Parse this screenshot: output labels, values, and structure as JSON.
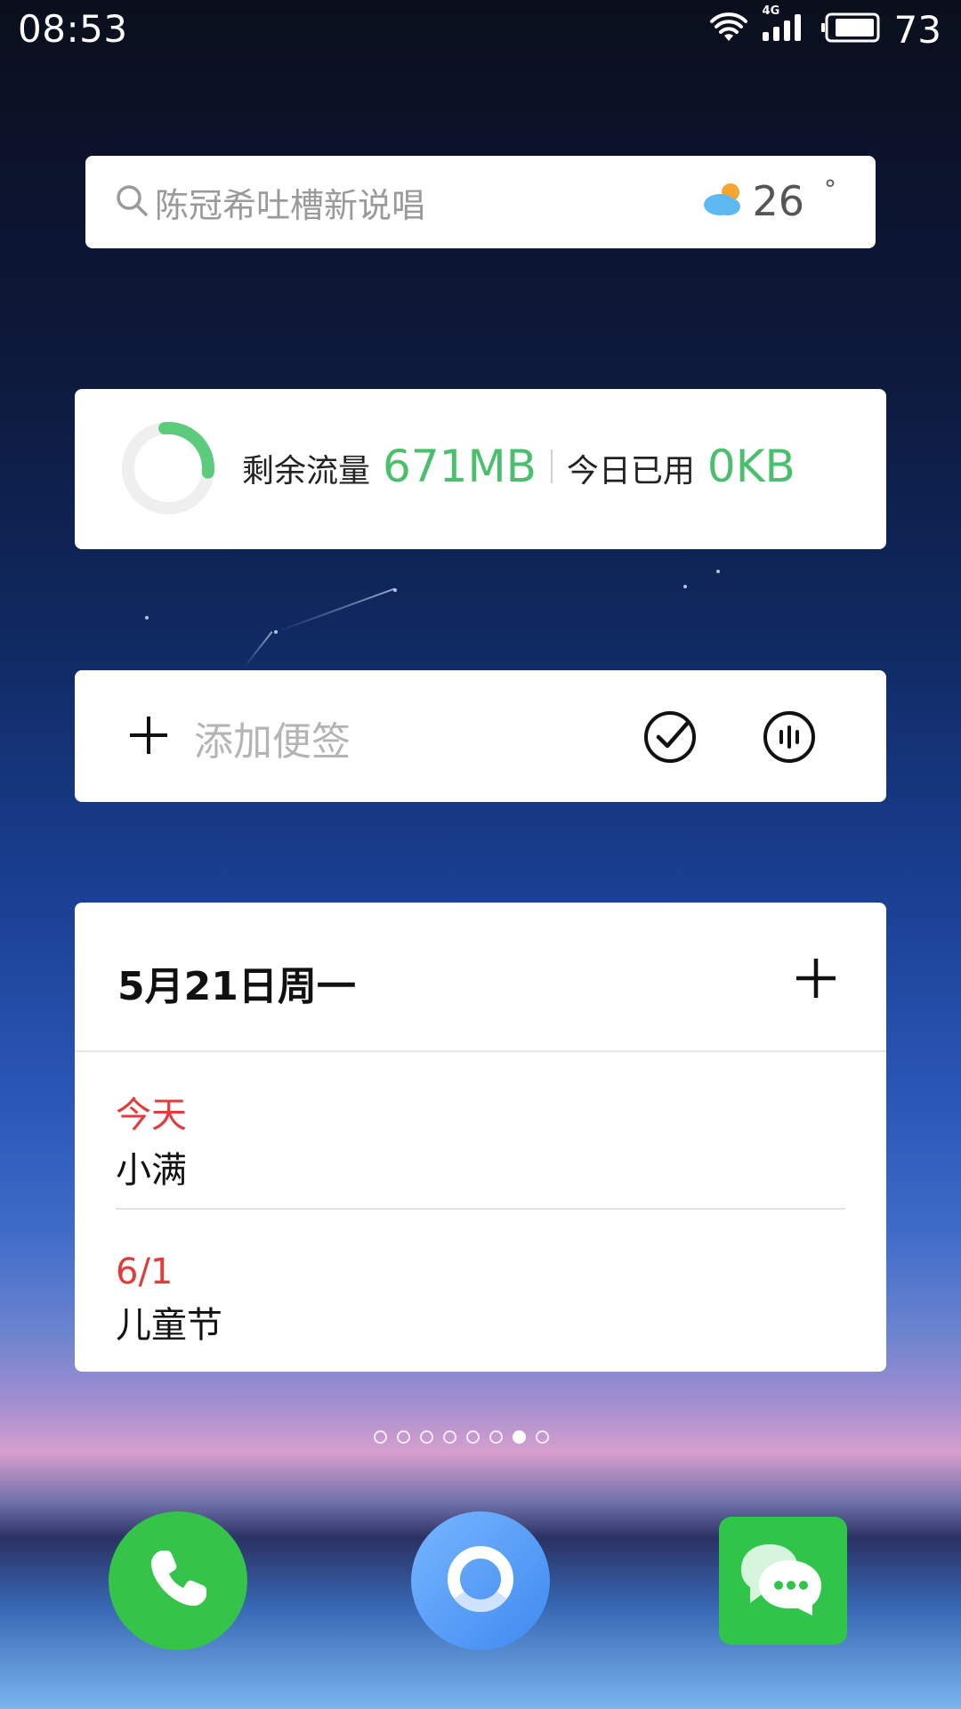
{
  "status_bar": {
    "time": "08:53",
    "network": "4G",
    "battery_percent": "73"
  },
  "search_widget": {
    "placeholder": "陈冠希吐槽新说唱",
    "weather_temp": "26",
    "weather_unit": "°",
    "weather_icon": "partly-cloudy-icon"
  },
  "data_usage_widget": {
    "remaining_label": "剩余流量",
    "remaining_value": "671MB",
    "today_label": "今日已用",
    "today_value": "0KB",
    "ring_fill_fraction": 0.28,
    "colors": {
      "accent": "#4bbf6e"
    }
  },
  "note_widget": {
    "add_icon": "plus-icon",
    "placeholder": "添加便签",
    "check_icon": "check-circle-icon",
    "voice_icon": "voice-icon"
  },
  "calendar_widget": {
    "date_title": "5月21日周一",
    "add_icon": "plus-icon",
    "events": [
      {
        "when": "今天",
        "name": "小满"
      },
      {
        "when": "6/1",
        "name": "儿童节"
      }
    ]
  },
  "page_indicator": {
    "count": 8,
    "active_index": 6
  },
  "dock": {
    "apps": [
      {
        "name": "phone",
        "icon": "phone-icon"
      },
      {
        "name": "browser",
        "icon": "browser-icon"
      },
      {
        "name": "messages",
        "icon": "messages-icon"
      }
    ]
  }
}
